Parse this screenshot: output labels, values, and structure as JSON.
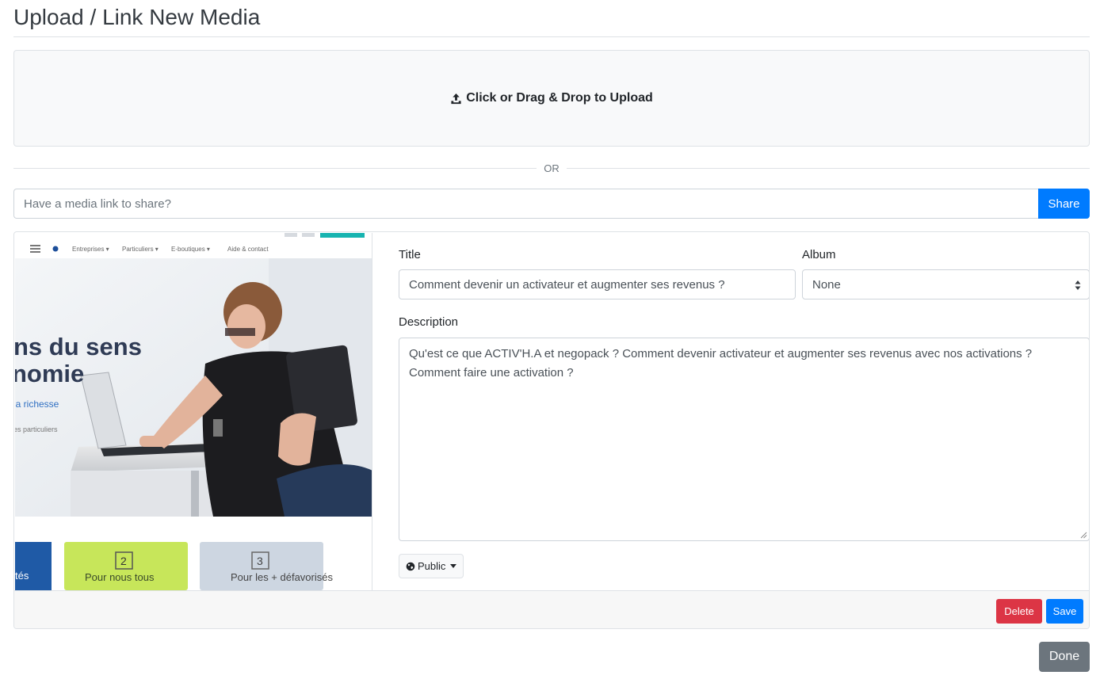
{
  "page": {
    "title": "Upload / Link New Media"
  },
  "dropzone": {
    "label": "Click or Drag & Drop to Upload",
    "icon": "upload-icon"
  },
  "divider": {
    "label": "OR"
  },
  "link": {
    "placeholder": "Have a media link to share?",
    "value": "",
    "share_label": "Share"
  },
  "media": {
    "thumbnail": {
      "nav_items": [
        "Entreprises ▾",
        "Particuliers ▾",
        "E-boutiques ▾",
        "Aide & contact"
      ],
      "headline_1": "ns du sens",
      "headline_2": "nomie",
      "link_text": "la richesse",
      "small_text": "es particuliers",
      "card_2_num": "2",
      "card_2_text": "Pour nous tous",
      "card_3_num": "3",
      "card_3_text": "Pour les + défavorisés",
      "card_1_text": "tés"
    },
    "title_label": "Title",
    "title_value": "Comment devenir un activateur et augmenter ses revenus ?",
    "album_label": "Album",
    "album_value": "None",
    "description_label": "Description",
    "description_value": "Qu'est ce que ACTIV'H.A et negopack ? Comment devenir activateur et augmenter ses revenus avec nos activations ? Comment faire une activation ?",
    "privacy_label": "Public",
    "delete_label": "Delete",
    "save_label": "Save"
  },
  "done_label": "Done",
  "colors": {
    "primary": "#007bff",
    "danger": "#dc3545",
    "secondary": "#6c757d"
  }
}
